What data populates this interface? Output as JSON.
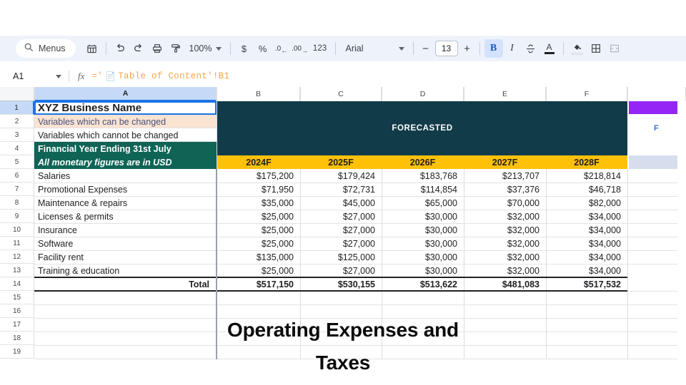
{
  "toolbar": {
    "menus_label": "Menus",
    "search_icon": "search-icon",
    "sheet_icon": "sheet-icon",
    "undo_icon": "undo-icon",
    "redo_icon": "redo-icon",
    "print_icon": "print-icon",
    "paint_format_icon": "paint-format-icon",
    "zoom_value": "100%",
    "currency_label": "$",
    "percent_label": "%",
    "decrease_decimal_label": ".0",
    "increase_decimal_label": ".00",
    "more_formats_label": "123",
    "font_name": "Arial",
    "font_size": "13",
    "decrease_size_label": "−",
    "increase_size_label": "+",
    "bold_label": "B",
    "italic_label": "I",
    "strikethrough_icon": "strikethrough-icon",
    "text_color_label": "A",
    "fill_color_icon": "fill-color-icon",
    "borders_icon": "borders-icon",
    "merge_icon": "merge-cells-icon"
  },
  "formula_bar": {
    "name_box": "A1",
    "fx_label": "fx",
    "doc_icon": "📄",
    "formula": "='",
    "formula_text": "='📄 Table of Content'!B1",
    "formula_after": " Table of Content'!B1"
  },
  "grid": {
    "columns": [
      "A",
      "B",
      "C",
      "D",
      "E",
      "F"
    ],
    "selected_column": "A",
    "selected_row": "1",
    "rows": [
      "1",
      "2",
      "3",
      "4",
      "5",
      "6",
      "7",
      "8",
      "9",
      "10",
      "11",
      "12",
      "13",
      "14",
      "15",
      "16",
      "17",
      "18",
      "19"
    ],
    "a1_value": "XYZ Business Name",
    "a2_value": "Variables which can be changed",
    "a3_value": "Variables which cannot be changed",
    "a4_value": "Financial Year Ending 31st July",
    "a5_value": "All monetary figures are in USD",
    "forecast_label": "FORECASTED",
    "year_headers": [
      "2024F",
      "2025F",
      "2026F",
      "2027F",
      "2028F"
    ],
    "total_label": "Total",
    "floating_letter": "F"
  },
  "chart_data": {
    "type": "table",
    "title": "Operating Expenses and Taxes",
    "categories": [
      "2024F",
      "2025F",
      "2026F",
      "2027F",
      "2028F"
    ],
    "rows": [
      {
        "label": "Salaries",
        "values": [
          "$175,200",
          "$179,424",
          "$183,768",
          "$213,707",
          "$218,814"
        ]
      },
      {
        "label": "Promotional Expenses",
        "values": [
          "$71,950",
          "$72,731",
          "$114,854",
          "$37,376",
          "$46,718"
        ]
      },
      {
        "label": "Maintenance & repairs",
        "values": [
          "$35,000",
          "$45,000",
          "$65,000",
          "$70,000",
          "$82,000"
        ]
      },
      {
        "label": "Licenses & permits",
        "values": [
          "$25,000",
          "$27,000",
          "$30,000",
          "$32,000",
          "$34,000"
        ]
      },
      {
        "label": "Insurance",
        "values": [
          "$25,000",
          "$27,000",
          "$30,000",
          "$32,000",
          "$34,000"
        ]
      },
      {
        "label": "Software",
        "values": [
          "$25,000",
          "$27,000",
          "$30,000",
          "$32,000",
          "$34,000"
        ]
      },
      {
        "label": "Facility rent",
        "values": [
          "$135,000",
          "$125,000",
          "$30,000",
          "$32,000",
          "$34,000"
        ]
      },
      {
        "label": "Training & education",
        "values": [
          "$25,000",
          "$27,000",
          "$30,000",
          "$32,000",
          "$34,000"
        ]
      }
    ],
    "total": {
      "label": "Total",
      "values": [
        "$517,150",
        "$530,155",
        "$513,622",
        "$481,083",
        "$517,532"
      ]
    }
  },
  "slide": {
    "title_line1": "Operating Expenses and",
    "title_line2": "Taxes"
  },
  "colors": {
    "forecast_band": "#113b49",
    "column_a_teal": "#0f6456",
    "year_header_gold": "#ffc107",
    "variables_peach": "#fbe3d2",
    "purple_block": "#9425f5",
    "selection_blue": "#1a73e8"
  }
}
